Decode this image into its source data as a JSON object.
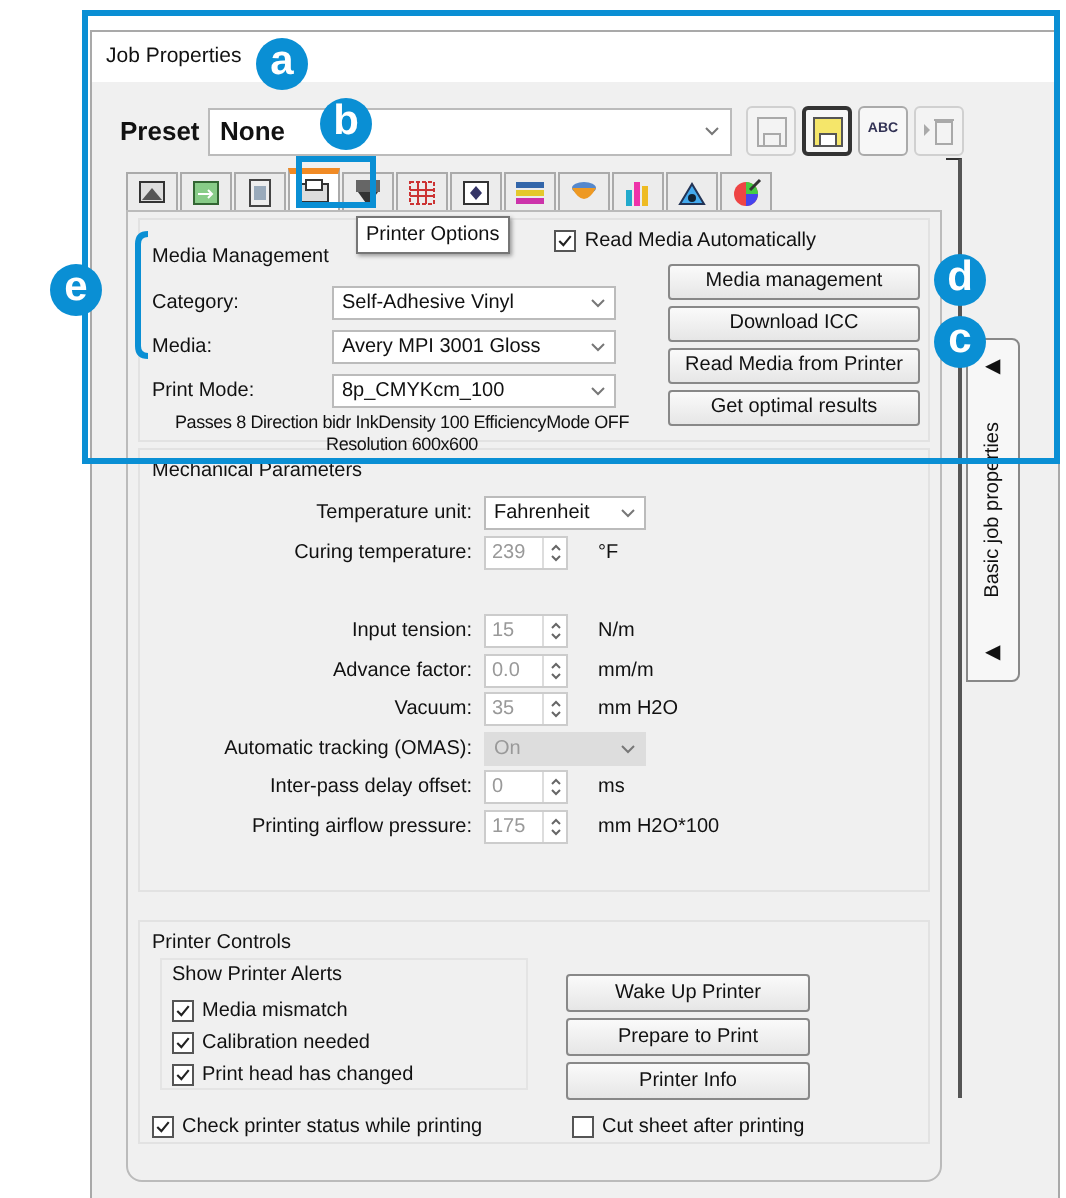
{
  "window": {
    "title": "Job Properties"
  },
  "preset": {
    "label": "Preset",
    "value": "None"
  },
  "preset_tools": [
    {
      "kind": "save",
      "disabled": true
    },
    {
      "kind": "save-as",
      "disabled": false
    },
    {
      "kind": "rename",
      "text": "ABC",
      "disabled": false
    },
    {
      "kind": "delete",
      "disabled": true
    }
  ],
  "tabs": [
    {
      "selected": false
    },
    {
      "selected": false
    },
    {
      "selected": false
    },
    {
      "selected": true
    },
    {
      "selected": false
    },
    {
      "selected": false
    },
    {
      "selected": false
    },
    {
      "selected": false
    },
    {
      "selected": false
    },
    {
      "selected": false
    },
    {
      "selected": false
    },
    {
      "selected": false
    }
  ],
  "tooltip": "Printer Options",
  "media_management": {
    "title": "Media Management",
    "read_media_automatically": {
      "label": "Read Media Automatically",
      "checked": true
    },
    "fields": [
      {
        "label": "Category:",
        "value": "Self-Adhesive Vinyl"
      },
      {
        "label": "Media:",
        "value": "Avery MPI 3001 Gloss"
      },
      {
        "label": "Print Mode:",
        "value": "8p_CMYKcm_100"
      }
    ],
    "info": [
      "Passes 8 Direction bidr InkDensity 100 EfficiencyMode OFF",
      "Resolution 600x600"
    ],
    "buttons": [
      "Media management",
      "Download ICC",
      "Read Media from Printer",
      "Get optimal results"
    ]
  },
  "mechanical_parameters": {
    "title": "Mechanical Parameters",
    "rows": [
      {
        "kind": "select",
        "label": "Temperature unit:",
        "value": "Fahrenheit",
        "disabled": false
      },
      {
        "kind": "spin",
        "label": "Curing temperature:",
        "value": "239",
        "unit": "°F",
        "disabled": true
      },
      {
        "kind": "gap"
      },
      {
        "kind": "spin",
        "label": "Input tension:",
        "value": "15",
        "unit": "N/m",
        "disabled": true
      },
      {
        "kind": "spin",
        "label": "Advance factor:",
        "value": "0.0",
        "unit": "mm/m",
        "disabled": true
      },
      {
        "kind": "spin",
        "label": "Vacuum:",
        "value": "35",
        "unit": "mm H2O",
        "disabled": true
      },
      {
        "kind": "select",
        "label": "Automatic tracking (OMAS):",
        "value": "On",
        "disabled": true
      },
      {
        "kind": "spin",
        "label": "Inter-pass delay offset:",
        "value": "0",
        "unit": "ms",
        "disabled": true
      },
      {
        "kind": "spin",
        "label": "Printing airflow pressure:",
        "value": "175",
        "unit": "mm H2O*100",
        "disabled": true
      }
    ]
  },
  "printer_controls": {
    "title": "Printer Controls",
    "alerts": {
      "title": "Show Printer Alerts",
      "items": [
        {
          "label": "Media mismatch",
          "checked": true
        },
        {
          "label": "Calibration needed",
          "checked": true
        },
        {
          "label": "Print head has changed",
          "checked": true
        }
      ]
    },
    "buttons": [
      "Wake Up Printer",
      "Prepare to Print",
      "Printer Info"
    ],
    "check_status": {
      "label": "Check printer status while printing",
      "checked": true
    },
    "cut_sheet": {
      "label": "Cut sheet after printing",
      "checked": false
    }
  },
  "side_panel": {
    "label": "Basic job properties",
    "arrows": [
      "◀",
      "◀"
    ]
  },
  "callouts": [
    {
      "letter": "a"
    },
    {
      "letter": "b"
    },
    {
      "letter": "e"
    },
    {
      "letter": "d"
    },
    {
      "letter": "c"
    }
  ]
}
